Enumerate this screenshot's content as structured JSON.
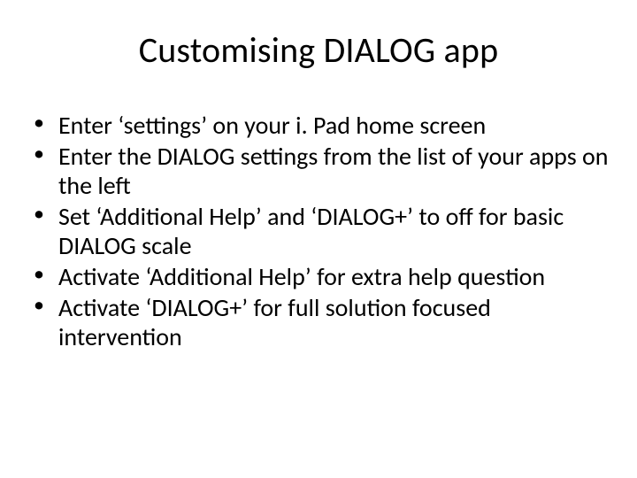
{
  "slide": {
    "title": "Customising DIALOG app",
    "bullets": [
      "Enter ‘settings’ on your i. Pad home screen",
      "Enter the DIALOG settings from the list of your apps on the left",
      "Set ‘Additional Help’ and ‘DIALOG+’ to off for basic DIALOG scale",
      "Activate ‘Additional Help’ for extra help question",
      "Activate ‘DIALOG+’ for full solution focused intervention"
    ]
  }
}
